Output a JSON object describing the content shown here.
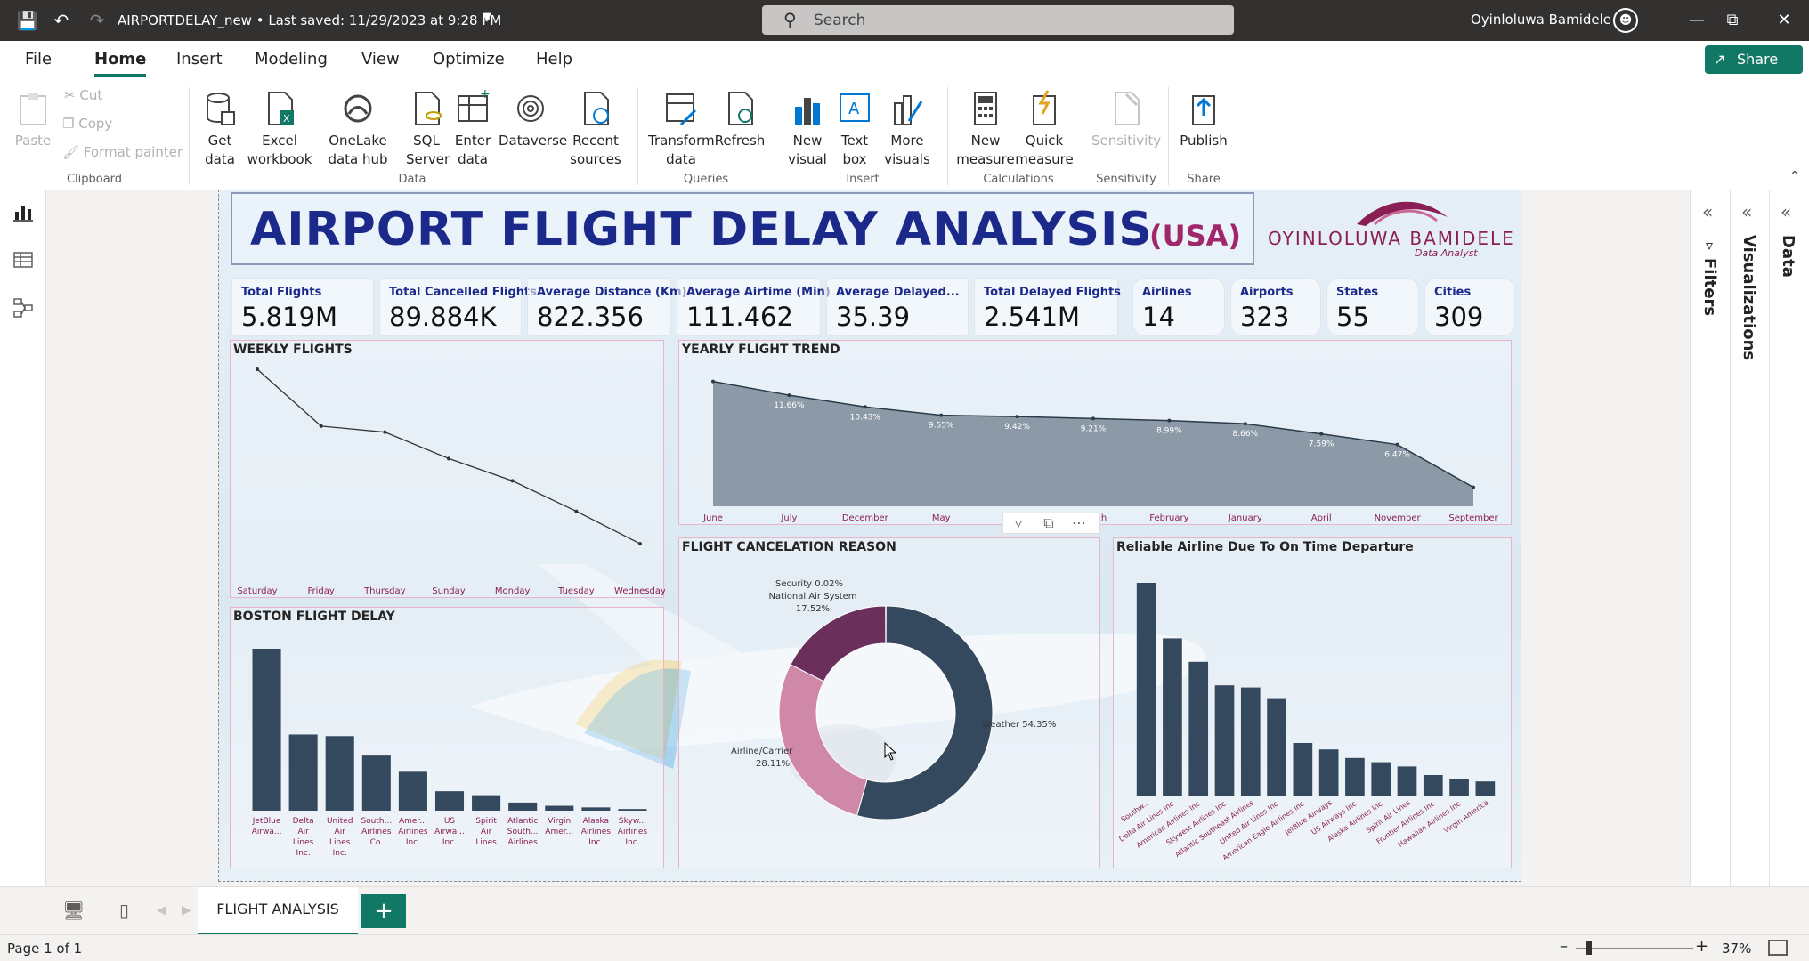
{
  "titlebar": {
    "doc_title": "AIRPORTDELAY_new  •  Last saved: 11/29/2023 at 9:28 PM",
    "search_placeholder": "Search",
    "user_name": "Oyinloluwa Bamidele"
  },
  "menu": {
    "file": "File",
    "home": "Home",
    "insert": "Insert",
    "modeling": "Modeling",
    "view": "View",
    "optimize": "Optimize",
    "help": "Help",
    "share": "Share"
  },
  "ribbon": {
    "paste": "Paste",
    "cut": "Cut",
    "copy": "Copy",
    "format_painter": "Format painter",
    "get_data": "Get data",
    "excel": "Excel workbook",
    "onelake": "OneLake data hub",
    "sql": "SQL Server",
    "enter_data": "Enter data",
    "dataverse": "Dataverse",
    "recent": "Recent sources",
    "transform": "Transform data",
    "refresh": "Refresh",
    "new_visual": "New visual",
    "text_box": "Text box",
    "more_visuals": "More visuals",
    "new_measure": "New measure",
    "quick_measure": "Quick measure",
    "sensitivity": "Sensitivity",
    "publish": "Publish",
    "groups": {
      "clipboard": "Clipboard",
      "data": "Data",
      "queries": "Queries",
      "insert": "Insert",
      "calculations": "Calculations",
      "sensitivity": "Sensitivity",
      "share": "Share"
    }
  },
  "report": {
    "title": "AIRPORT FLIGHT DELAY ANALYSIS",
    "title_suffix": "(USA)",
    "logo_name": "OYINLOLUWA BAMIDELE",
    "logo_sub": "Data Analyst",
    "kpis": [
      {
        "label": "Total Flights",
        "value": "5.819M"
      },
      {
        "label": "Total Cancelled Flights",
        "value": "89.884K"
      },
      {
        "label": "Average Distance (Km)",
        "value": "822.356"
      },
      {
        "label": "Average Airtime (Min)",
        "value": "111.462"
      },
      {
        "label": "Average Delayed...",
        "value": "35.39"
      },
      {
        "label": "Total Delayed Flights",
        "value": "2.541M"
      },
      {
        "label": "Airlines",
        "value": "14"
      },
      {
        "label": "Airports",
        "value": "323"
      },
      {
        "label": "States",
        "value": "55"
      },
      {
        "label": "Cities",
        "value": "309"
      }
    ],
    "panel_titles": {
      "weekly": "WEEKLY FLIGHTS",
      "yearly": "YEARLY FLIGHT TREND",
      "boston": "BOSTON FLIGHT DELAY",
      "cancel": "FLIGHT CANCELATION REASON",
      "reliable": "Reliable Airline Due To On Time Departure"
    }
  },
  "pane_labels": {
    "filters": "Filters",
    "visualizations": "Visualizations",
    "data": "Data"
  },
  "tabs": {
    "page": "FLIGHT ANALYSIS",
    "add": "+"
  },
  "status": {
    "page_count": "Page 1 of 1",
    "zoom": "37%"
  },
  "colors": {
    "accent": "#117865",
    "title_blue": "#1b2a8a",
    "title_magenta": "#a0276a",
    "bar": "#34495e",
    "pink": "#d088a8",
    "purple": "#6b2f5b"
  },
  "chart_data": [
    {
      "type": "line",
      "title": "WEEKLY FLIGHTS",
      "categories": [
        "Saturday",
        "Friday",
        "Thursday",
        "Sunday",
        "Monday",
        "Tuesday",
        "Wednesday"
      ],
      "values": [
        100,
        72,
        69,
        56,
        45,
        30,
        14
      ]
    },
    {
      "type": "area",
      "title": "YEARLY FLIGHT TREND",
      "categories": [
        "June",
        "July",
        "December",
        "May",
        "",
        "March",
        "February",
        "January",
        "April",
        "November",
        "September"
      ],
      "labels": [
        "",
        "11.66%",
        "10.43%",
        "9.55%",
        "9.42%",
        "9.21%",
        "8.99%",
        "8.66%",
        "7.59%",
        "6.47%",
        ""
      ],
      "values": [
        13.1,
        11.66,
        10.43,
        9.55,
        9.42,
        9.21,
        8.99,
        8.66,
        7.59,
        6.47,
        2.0
      ]
    },
    {
      "type": "bar",
      "title": "BOSTON FLIGHT DELAY",
      "categories": [
        [
          "JetBlue",
          "Airwa..."
        ],
        [
          "Delta",
          "Air",
          "Lines",
          "Inc."
        ],
        [
          "United",
          "Air",
          "Lines",
          "Inc."
        ],
        [
          "South...",
          "Airlines",
          "Co."
        ],
        [
          "Amer...",
          "Airlines",
          "Inc."
        ],
        [
          "US",
          "Airwa...",
          "Inc."
        ],
        [
          "Spirit",
          "Air",
          "Lines"
        ],
        [
          "Atlantic",
          "South...",
          "Airlines"
        ],
        [
          "Virgin",
          "Amer..."
        ],
        [
          "Alaska",
          "Airlines",
          "Inc."
        ],
        [
          "Skyw...",
          "Airlines",
          "Inc."
        ]
      ],
      "values": [
        100,
        47,
        46,
        34,
        24,
        12,
        9,
        5,
        3,
        2,
        1
      ]
    },
    {
      "type": "pie",
      "title": "FLIGHT CANCELATION REASON",
      "slices": [
        {
          "name": "Weather",
          "label": "Weather 54.35%",
          "value": 54.35,
          "color": "#34495e"
        },
        {
          "name": "Airline/Carrier",
          "label": "Airline/Carrier 28.11%",
          "value": 28.11,
          "color": "#d088a8"
        },
        {
          "name": "National Air System",
          "label": "National Air System 17.52%",
          "value": 17.52,
          "color": "#6b2f5b"
        },
        {
          "name": "Security",
          "label": "Security 0.02%",
          "value": 0.02,
          "color": "#8a1f55"
        }
      ]
    },
    {
      "type": "bar",
      "title": "Reliable Airline Due To On Time Departure",
      "categories": [
        "Southw...",
        "Delta Air Lines Inc.",
        "American Airlines Inc.",
        "Skywest Airlines Inc.",
        "Atlantic Southeast Airlines",
        "United Air Lines Inc.",
        "American Eagle Airlines Inc.",
        "JetBlue Airways",
        "US Airways Inc.",
        "Alaska Airlines Inc.",
        "Spirit Air Lines",
        "Frontier Airlines Inc.",
        "Hawaiian Airlines Inc.",
        "Virgin America"
      ],
      "values": [
        100,
        74,
        63,
        52,
        51,
        46,
        25,
        22,
        18,
        16,
        14,
        10,
        8,
        7
      ]
    }
  ]
}
